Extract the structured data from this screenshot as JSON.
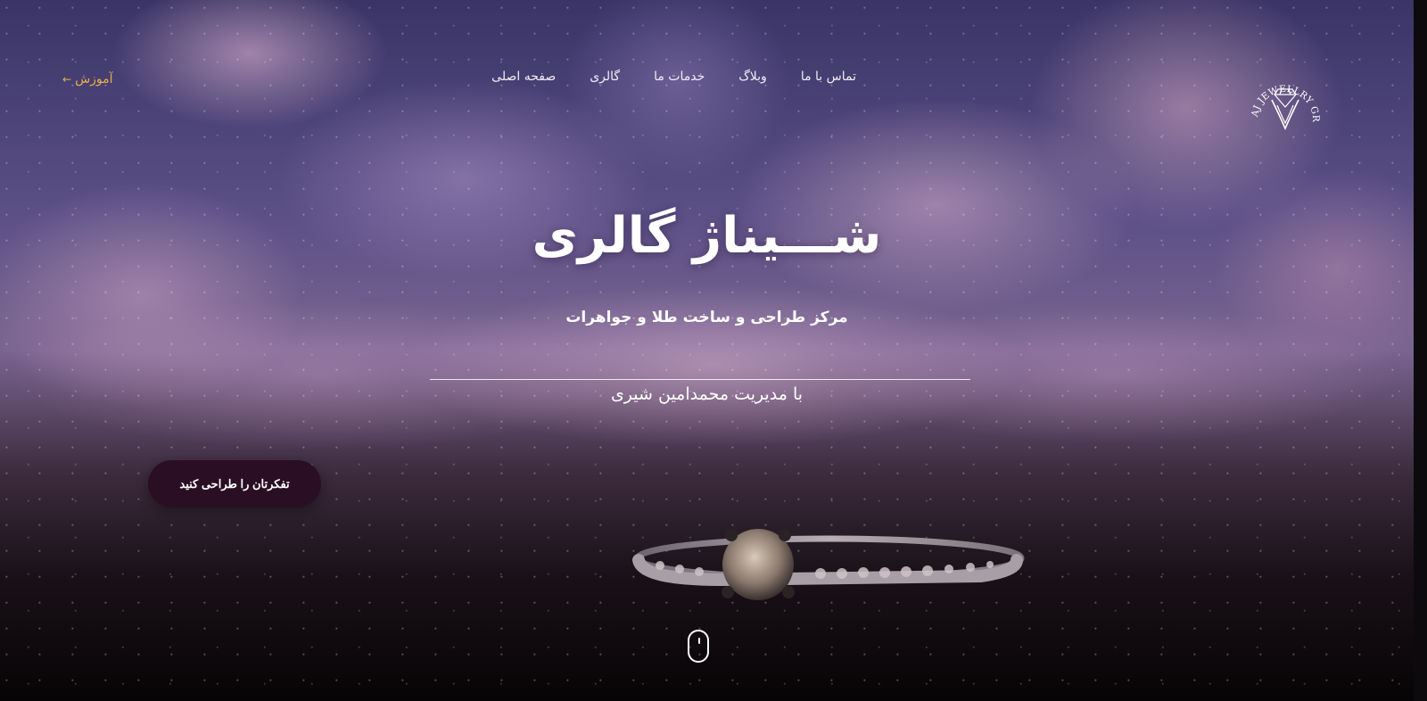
{
  "brand": {
    "logo_text": "SHINAJ JEWELLRY GROUP",
    "logo_icon": "diamond-icon"
  },
  "nav": {
    "items": [
      {
        "label": "صفحه اصلی"
      },
      {
        "label": "گالری"
      },
      {
        "label": "خدمات ما"
      },
      {
        "label": "وبلاگ"
      },
      {
        "label": "تماس با ما"
      }
    ],
    "learn_label": "آموزش",
    "learn_icon": "arrow-left-icon"
  },
  "hero": {
    "title": "شـــیناژ گالری",
    "subtitle": "مرکز طراحی و ساخت طلا و جواهرات",
    "manager": "با مدیریت محمدامین شیری",
    "cta_label": "تفکرتان را طراحی کنید",
    "scroll_icon": "mouse-scroll-icon"
  },
  "colors": {
    "accent": "#e8b04a",
    "cta_bg": "#2a0f24",
    "text": "#ffffff"
  }
}
